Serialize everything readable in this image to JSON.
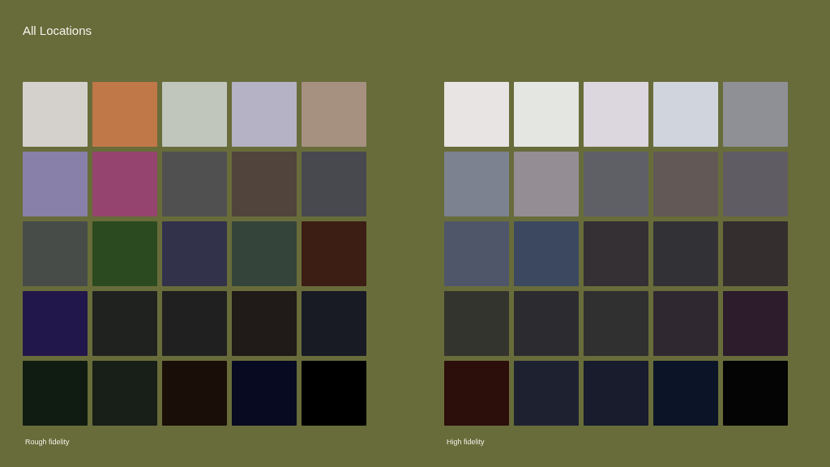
{
  "title": "All Locations",
  "palettes": [
    {
      "label": "Rough fidelity",
      "swatches": [
        {
          "color": "#d4d0cc"
        },
        {
          "color": "#c07848"
        },
        {
          "color": "#c0c6bc"
        },
        {
          "color": "#b4b2c4"
        },
        {
          "color": "#a69080"
        },
        {
          "color": "#8880a8"
        },
        {
          "color": "#94446e"
        },
        {
          "color": "#505050"
        },
        {
          "color": "#50443c"
        },
        {
          "color": "#48484f"
        },
        {
          "color": "#484c48"
        },
        {
          "color": "#2c4a20"
        },
        {
          "color": "#32324a"
        },
        {
          "color": "#34443a"
        },
        {
          "color": "#3c1e14"
        },
        {
          "color": "#22174a"
        },
        {
          "color": "#202220"
        },
        {
          "color": "#202020"
        },
        {
          "color": "#201a18"
        },
        {
          "color": "#181a24"
        },
        {
          "color": "#101c12"
        },
        {
          "color": "#181e18"
        },
        {
          "color": "#1a0e08"
        },
        {
          "color": "#080a22"
        },
        {
          "color": "#000000"
        }
      ]
    },
    {
      "label": "High fidelity",
      "swatches": [
        {
          "color": "#e8e4e4"
        },
        {
          "color": "#e4e6e2"
        },
        {
          "color": "#dcd6de"
        },
        {
          "color": "#d0d4dc"
        },
        {
          "color": "#8e9096"
        },
        {
          "color": "#7c8290"
        },
        {
          "color": "#948e94"
        },
        {
          "color": "#5e6066"
        },
        {
          "color": "#625856"
        },
        {
          "color": "#605c64"
        },
        {
          "color": "#50566a"
        },
        {
          "color": "#3c4860"
        },
        {
          "color": "#343034"
        },
        {
          "color": "#323236"
        },
        {
          "color": "#342e2e"
        },
        {
          "color": "#34342e"
        },
        {
          "color": "#2c2c30"
        },
        {
          "color": "#303030"
        },
        {
          "color": "#302830"
        },
        {
          "color": "#2c1c2c"
        },
        {
          "color": "#2c0e0a"
        },
        {
          "color": "#1e2230"
        },
        {
          "color": "#181c2c"
        },
        {
          "color": "#0c1428"
        },
        {
          "color": "#040404"
        }
      ]
    }
  ]
}
